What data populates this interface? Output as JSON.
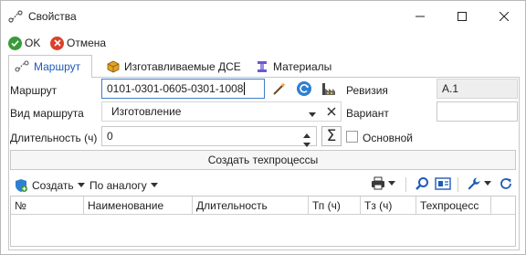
{
  "window": {
    "title": "Свойства"
  },
  "toolbar": {
    "ok_label": "OK",
    "cancel_label": "Отмена"
  },
  "tabs": [
    {
      "label": "Маршрут",
      "active": true
    },
    {
      "label": "Изготавливаемые ДСЕ",
      "active": false
    },
    {
      "label": "Материалы",
      "active": false
    }
  ],
  "form": {
    "route_label": "Маршрут",
    "route_value": "0101-0301-0605-0301-1008",
    "revision_label": "Ревизия",
    "revision_value": "А.1",
    "route_type_label": "Вид маршрута",
    "route_type_value": "Изготовление",
    "variant_label": "Вариант",
    "variant_value": "",
    "duration_label": "Длительность (ч)",
    "duration_value": "0",
    "main_label": "Основной",
    "main_checked": false
  },
  "create_processes_label": "Создать техпроцессы",
  "toolbar2": {
    "create_label": "Создать",
    "by_analogy_label": "По аналогу"
  },
  "grid": {
    "columns": [
      "№",
      "Наименование",
      "Длительность",
      "Тп (ч)",
      "Тз (ч)",
      "Техпроцесс"
    ],
    "rows": []
  },
  "colors": {
    "accent": "#1e5bb7",
    "ok": "#3a9a3a",
    "cancel": "#d9412d"
  }
}
